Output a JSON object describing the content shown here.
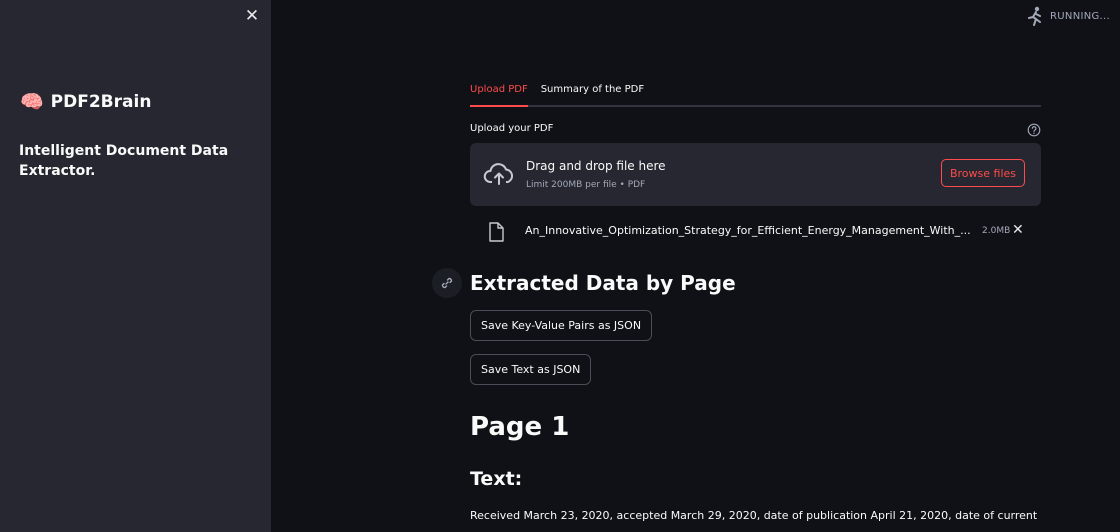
{
  "sidebar": {
    "close_symbol": "✕",
    "brand_icon": "brain-icon",
    "brand_emoji": "🧠",
    "brand_name": "PDF2Brain",
    "tagline": "Intelligent Document Data Extractor."
  },
  "status": {
    "label": "RUNNING..."
  },
  "tabs": [
    {
      "label": "Upload PDF",
      "active": true
    },
    {
      "label": "Summary of the PDF",
      "active": false
    }
  ],
  "uploader": {
    "label": "Upload your PDF",
    "drop_title": "Drag and drop file here",
    "drop_limit": "Limit 200MB per file • PDF",
    "browse_label": "Browse files",
    "file": {
      "name": "An_Innovative_Optimization_Strategy_for_Efficient_Energy_Management_With_...",
      "size": "2.0MB"
    },
    "remove_symbol": "✕"
  },
  "extracted": {
    "heading": "Extracted Data by Page",
    "save_kv_label": "Save Key-Value Pairs as JSON",
    "save_text_label": "Save Text as JSON"
  },
  "page": {
    "heading": "Page 1",
    "text_heading": "Text:",
    "text_preview": "Received March 23, 2020, accepted March 29, 2020, date of publication April 21, 2020, date of current"
  },
  "colors": {
    "accent": "#ff4b4b",
    "background": "#0f1116",
    "sidebar": "#262730",
    "text": "#fafafa",
    "muted": "#a3a8b8"
  }
}
